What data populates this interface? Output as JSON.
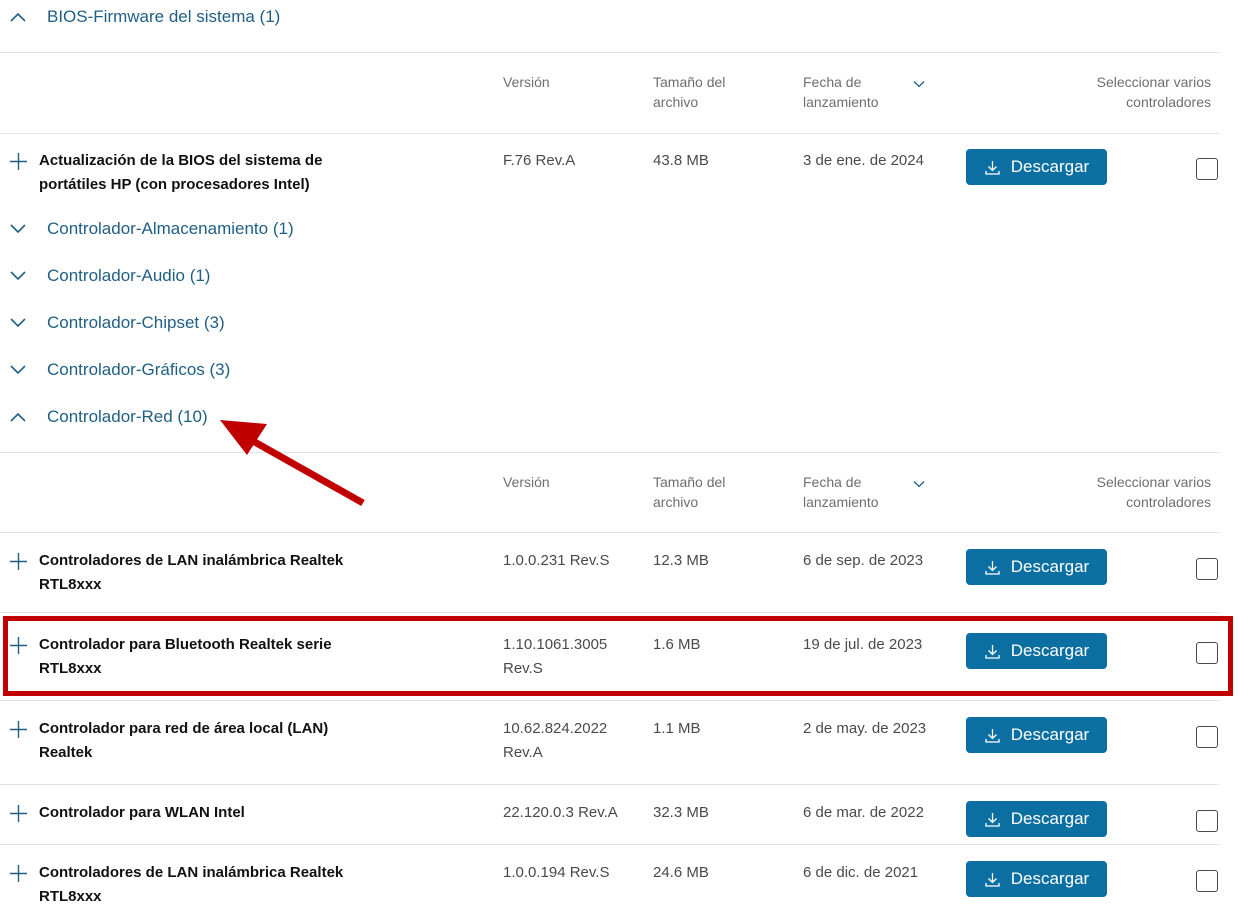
{
  "categories": {
    "bios": "BIOS-Firmware del sistema (1)",
    "almacenamiento": "Controlador-Almacenamiento (1)",
    "audio": "Controlador-Audio (1)",
    "chipset": "Controlador-Chipset (3)",
    "graficos": "Controlador-Gráficos (3)",
    "red": "Controlador-Red (10)"
  },
  "headers": {
    "version": "Versión",
    "size_l1": "Tamaño del",
    "size_l2": "archivo",
    "date_l1": "Fecha de",
    "date_l2": "lanzamiento",
    "select_l1": "Seleccionar varios",
    "select_l2": "controladores"
  },
  "download_label": "Descargar",
  "bios_rows": [
    {
      "name_l1": "Actualización de la BIOS del sistema de",
      "name_l2": "portátiles HP (con procesadores Intel)",
      "version_l1": "F.76 Rev.A",
      "size": "43.8 MB",
      "date": "3 de ene. de 2024"
    }
  ],
  "red_rows": [
    {
      "name_l1": "Controladores de LAN inalámbrica Realtek",
      "name_l2": "RTL8xxx",
      "version_l1": "1.0.0.231 Rev.S",
      "size": "12.3 MB",
      "date": "6 de sep. de 2023"
    },
    {
      "name_l1": "Controlador para Bluetooth Realtek serie",
      "name_l2": "RTL8xxx",
      "version_l1": "1.10.1061.3005",
      "version_l2": "Rev.S",
      "size": "1.6 MB",
      "date": "19 de jul. de 2023"
    },
    {
      "name_l1": "Controlador para red de área local (LAN)",
      "name_l2": "Realtek",
      "version_l1": "10.62.824.2022",
      "version_l2": "Rev.A",
      "size": "1.1 MB",
      "date": "2 de may. de 2023"
    },
    {
      "name_l1": "Controlador para WLAN Intel",
      "version_l1": "22.120.0.3 Rev.A",
      "size": "32.3 MB",
      "date": "6 de mar. de 2022"
    },
    {
      "name_l1": "Controladores de LAN inalámbrica Realtek",
      "name_l2": "RTL8xxx",
      "version_l1": "1.0.0.194 Rev.S",
      "size": "24.6 MB",
      "date": "6 de dic. de 2021"
    }
  ],
  "colors": {
    "accent": "#0b6fa1",
    "link": "#1f5f85",
    "highlight": "#c00000"
  }
}
